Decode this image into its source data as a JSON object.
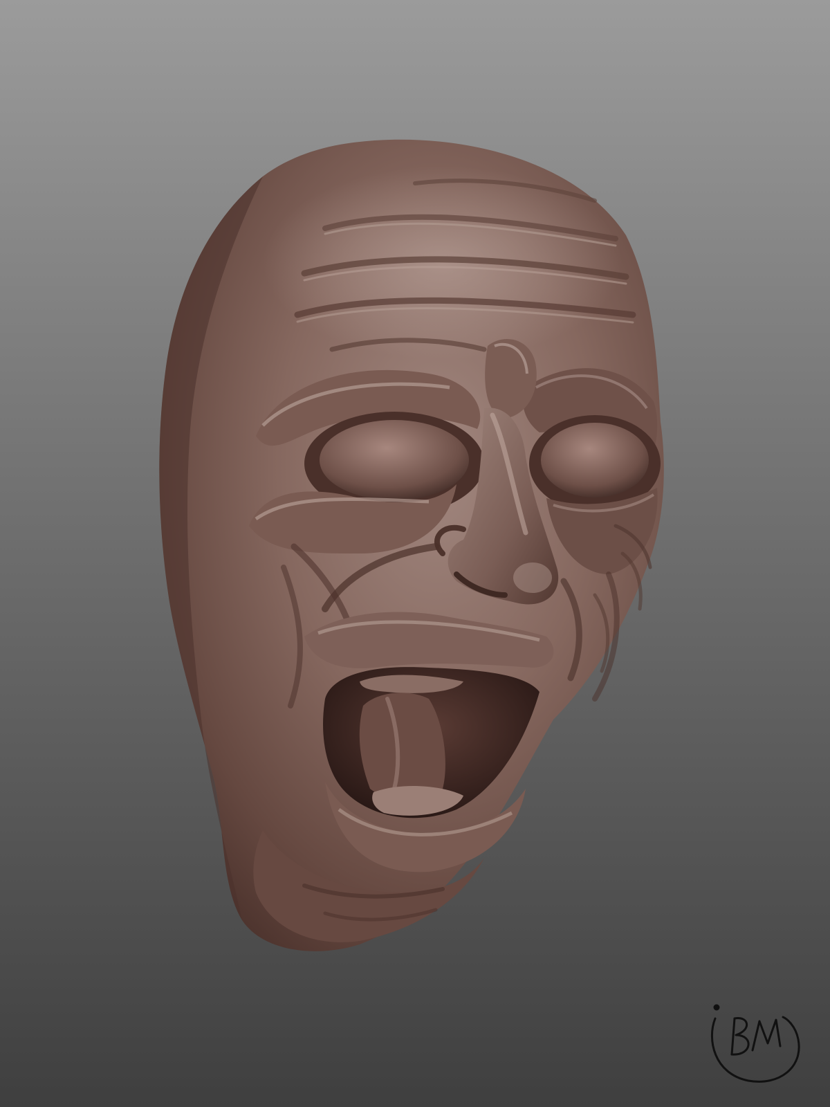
{
  "image": {
    "subject": "sculpted-screaming-face",
    "colors": {
      "background_top": "#9b9b9b",
      "background_bottom": "#3f3f3f",
      "skin_base": "#7d5f57",
      "skin_highlight": "#a89088",
      "skin_shadow": "#4a322c",
      "mouth_interior": "#3a2420",
      "signature_ink": "#111111"
    }
  },
  "signature": {
    "mark": "BM"
  }
}
